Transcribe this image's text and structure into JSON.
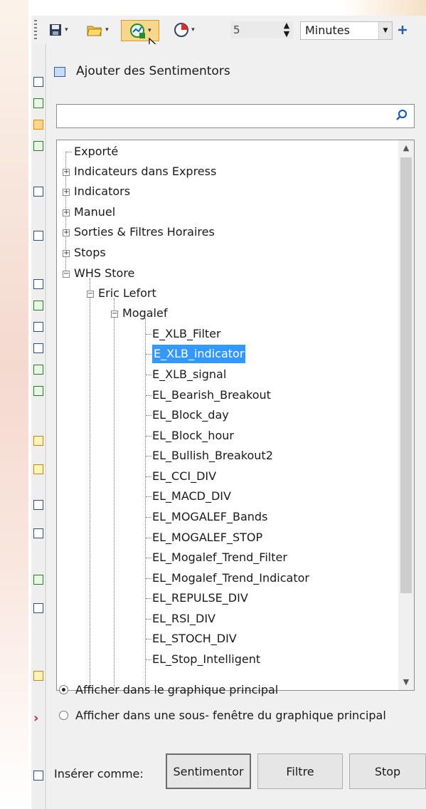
{
  "toolbar": {
    "interval_value": "5",
    "interval_unit": "Minutes"
  },
  "dialog": {
    "title": "Ajouter des Sentimentors",
    "search_placeholder": ""
  },
  "tree": {
    "roots": [
      "Exporté",
      "Indicateurs dans Express",
      "Indicators",
      "Manuel",
      "Sorties & Filtres Horaires",
      "Stops",
      "WHS Store"
    ],
    "level1": "Eric Lefort",
    "level2": "Mogalef",
    "items": [
      "E_XLB_Filter",
      "E_XLB_indicator",
      "E_XLB_signal",
      "EL_Bearish_Breakout",
      "EL_Block_day",
      "EL_Block_hour",
      "EL_Bullish_Breakout2",
      "EL_CCI_DIV",
      "EL_MACD_DIV",
      "EL_MOGALEF_Bands",
      "EL_MOGALEF_STOP",
      "EL_Mogalef_Trend_Filter",
      "EL_Mogalef_Trend_Indicator",
      "EL_REPULSE_DIV",
      "EL_RSI_DIV",
      "EL_STOCH_DIV",
      "EL_Stop_Intelligent"
    ],
    "selected_item": "E_XLB_indicator"
  },
  "options": {
    "main_chart": "Afficher dans le graphique principal",
    "sub_window": "Afficher dans une sous- fenêtre du graphique principal",
    "selected": "main_chart"
  },
  "insert": {
    "label": "Insérer comme:",
    "buttons": [
      "Sentimentor",
      "Filtre",
      "Stop"
    ]
  },
  "icons": [
    "save-icon",
    "open-folder-icon",
    "add-indicator-icon",
    "clock-icon",
    "search-icon",
    "expand-plus-icon",
    "collapse-minus-icon"
  ]
}
